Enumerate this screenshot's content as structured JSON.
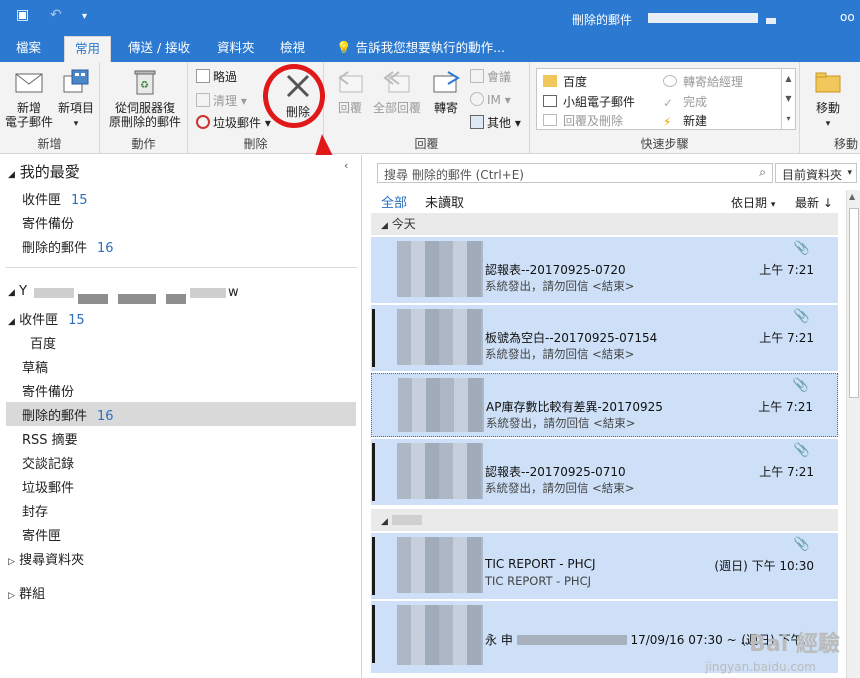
{
  "window": {
    "title": "刪除的郵件"
  },
  "tabs": [
    "檔案",
    "常用",
    "傳送 / 接收",
    "資料夾",
    "檢視",
    "告訴我您想要執行的動作..."
  ],
  "ribbon": {
    "new_group": {
      "label": "新增",
      "new_email": "新增\n電子郵件",
      "new_items": "新項目"
    },
    "actions_group": {
      "label": "動作",
      "recover": "從伺服器復\n原刪除的郵件"
    },
    "delete_group": {
      "label": "刪除",
      "ignore": "略過",
      "cleanup": "清理",
      "junk": "垃圾郵件",
      "delete": "刪除"
    },
    "respond_group": {
      "label": "回覆",
      "reply": "回覆",
      "reply_all": "全部回覆",
      "forward": "轉寄",
      "meeting": "會議",
      "im": "IM",
      "more": "其他"
    },
    "quicksteps_group": {
      "label": "快速步驟",
      "items": [
        "百度",
        "小組電子郵件",
        "回覆及刪除",
        "轉寄給經理",
        "完成",
        "新建"
      ]
    },
    "move_group": {
      "label": "移動",
      "move": "移動"
    }
  },
  "nav": {
    "favorites_header": "我的最愛",
    "favorites": [
      {
        "label": "收件匣",
        "count": "15"
      },
      {
        "label": "寄件備份",
        "count": ""
      },
      {
        "label": "刪除的郵件",
        "count": "16"
      }
    ],
    "account_initial": "Y",
    "account_suffix": "w",
    "folders": [
      {
        "label": "收件匣",
        "count": "15"
      },
      {
        "label": "百度",
        "count": ""
      },
      {
        "label": "草稿",
        "count": ""
      },
      {
        "label": "寄件備份",
        "count": ""
      },
      {
        "label": "刪除的郵件",
        "count": "16"
      },
      {
        "label": "RSS 摘要",
        "count": ""
      },
      {
        "label": "交談記錄",
        "count": ""
      },
      {
        "label": "垃圾郵件",
        "count": ""
      },
      {
        "label": "封存",
        "count": ""
      },
      {
        "label": "寄件匣",
        "count": ""
      },
      {
        "label": "搜尋資料夾",
        "count": ""
      },
      {
        "label": "群組",
        "count": ""
      }
    ]
  },
  "mail": {
    "search_placeholder": "搜尋 刪除的郵件 (Ctrl+E)",
    "scope": "目前資料夾",
    "filter_all": "全部",
    "filter_unread": "未讀取",
    "sort_by": "依日期",
    "sort_order": "最新 ↓",
    "group_today": "今天",
    "messages": [
      {
        "subject": "認報表--20170925-0720",
        "preview": "系統發出，請勿回信 <結束>",
        "time": "上午 7:21"
      },
      {
        "subject": "板號為空白--20170925-07154",
        "preview": "系統發出，請勿回信 <結束>",
        "time": "上午 7:21"
      },
      {
        "subject": "AP庫存數比較有差異-20170925",
        "preview": "系統發出，請勿回信 <結束>",
        "time": "上午 7:21"
      },
      {
        "subject": "認報表--20170925-0710",
        "preview": "系統發出，請勿回信 <結束>",
        "time": "上午 7:21"
      },
      {
        "subject": "TIC REPORT - PHCJ",
        "preview": "TIC REPORT - PHCJ",
        "time": "(週日) 下午 10:30"
      },
      {
        "subject": "永 申",
        "preview": "17/09/16 07:30 ~ ..",
        "time": "(週日) 下午..."
      }
    ]
  },
  "watermark": {
    "main": "Bai 經驗",
    "sub": "jingyan.baidu.com"
  }
}
